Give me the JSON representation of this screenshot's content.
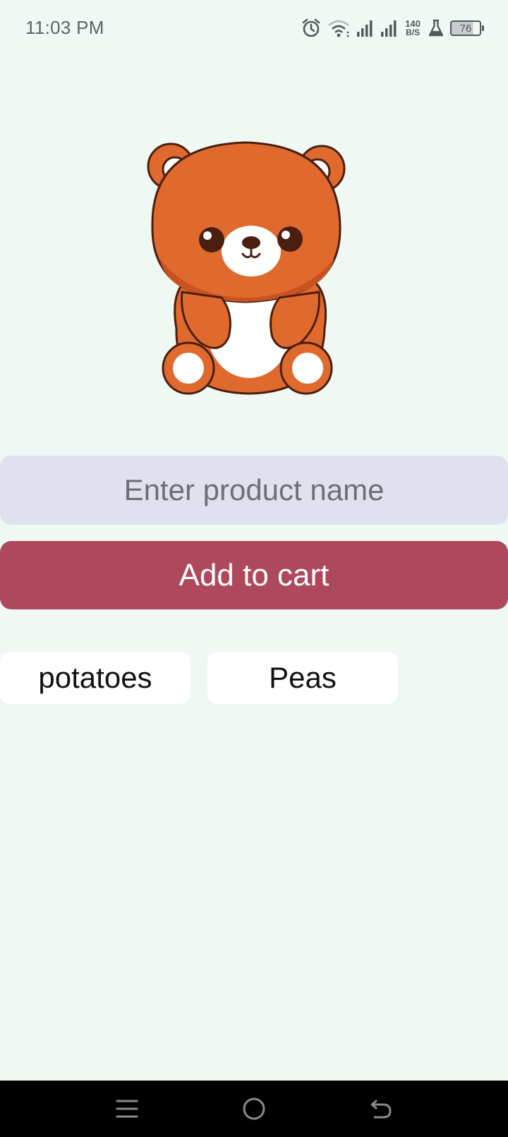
{
  "status_bar": {
    "time": "11:03 PM",
    "net_speed_value": "140",
    "net_speed_unit": "B/S",
    "battery_level": "76",
    "icons": [
      "alarm-icon",
      "wifi-icon",
      "signal-icon",
      "signal-icon",
      "lab-flask-icon",
      "battery-icon"
    ]
  },
  "hero": {
    "image": "teddy-bear-illustration",
    "colors": {
      "fur": "#e06a2e",
      "outline": "#4a1f10",
      "muzzle": "#ffffff"
    }
  },
  "form": {
    "product_input": {
      "placeholder": "Enter product name",
      "value": ""
    },
    "add_button_label": "Add to cart"
  },
  "cart": {
    "items": [
      {
        "label": "potatoes"
      },
      {
        "label": "Peas"
      }
    ]
  },
  "nav_bar": {
    "buttons": [
      "menu-icon",
      "home-icon",
      "back-icon"
    ]
  },
  "colors": {
    "background": "#eff8f3",
    "input_bg": "#dfe2ee",
    "button_bg": "#ae485c",
    "chip_bg": "#ffffff"
  }
}
